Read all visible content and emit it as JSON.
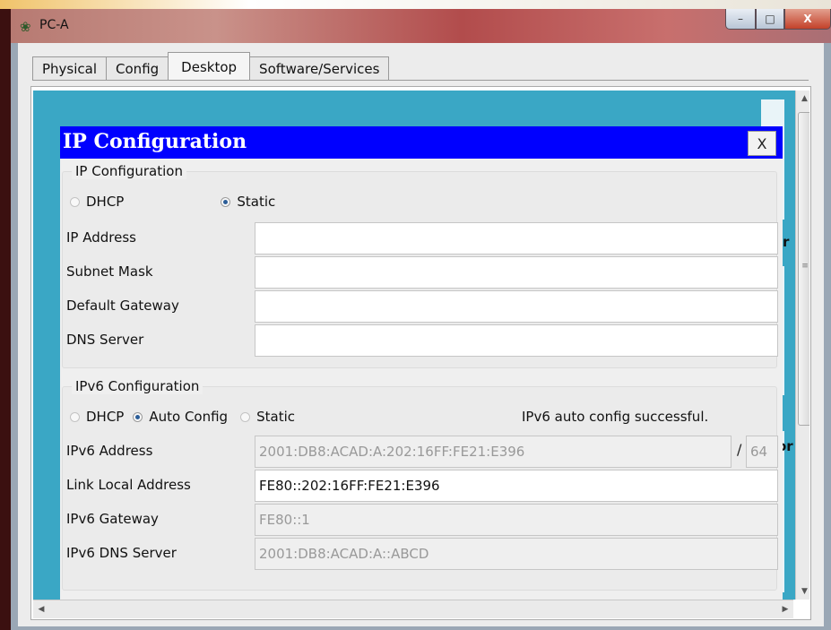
{
  "window": {
    "title": "PC-A",
    "min_glyph": "–",
    "max_glyph": "□",
    "close_glyph": "X"
  },
  "tabs": [
    "Physical",
    "Config",
    "Desktop",
    "Software/Services"
  ],
  "active_tab": "Desktop",
  "desktop_peek": {
    "right_text_1": "r",
    "right_text_2": "or"
  },
  "dialog": {
    "title": "IP Configuration",
    "close_label": "X",
    "ipv4": {
      "legend": "IP Configuration",
      "dhcp_label": "DHCP",
      "static_label": "Static",
      "selected": "Static",
      "fields": [
        {
          "label": "IP Address",
          "value": ""
        },
        {
          "label": "Subnet Mask",
          "value": ""
        },
        {
          "label": "Default Gateway",
          "value": ""
        },
        {
          "label": "DNS Server",
          "value": ""
        }
      ]
    },
    "ipv6": {
      "legend": "IPv6 Configuration",
      "dhcp_label": "DHCP",
      "auto_label": "Auto Config",
      "static_label": "Static",
      "selected": "Auto Config",
      "status": "IPv6 auto config successful.",
      "address_label": "IPv6 Address",
      "address_value": "2001:DB8:ACAD:A:202:16FF:FE21:E396",
      "prefix_sep": "/",
      "prefix_value": "64",
      "link_local_label": "Link Local Address",
      "link_local_value": "FE80::202:16FF:FE21:E396",
      "gateway_label": "IPv6 Gateway",
      "gateway_value": "FE80::1",
      "dns_label": "IPv6 DNS Server",
      "dns_value": "2001:DB8:ACAD:A::ABCD"
    }
  },
  "scroll": {
    "up_arrow": "▲",
    "down_arrow": "▼",
    "left_arrow": "◀",
    "right_arrow": "▶",
    "grip": "≡"
  },
  "colors": {
    "dialog_title_bg": "#0000ff",
    "desktop_bg": "#3aa7c5",
    "radio_selected": "#2b5d98"
  }
}
